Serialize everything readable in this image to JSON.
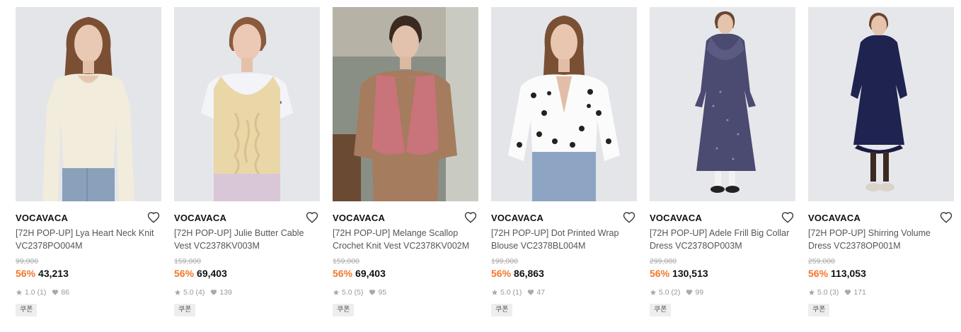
{
  "products": [
    {
      "brand": "VOCAVACA",
      "title": "[72H POP-UP] Lya Heart Neck Knit VC2378PO004M",
      "original_price": "99,000",
      "discount": "56%",
      "price": "43,213",
      "rating": "1.0",
      "reviews": "(1)",
      "likes": "86",
      "coupon": "쿠폰"
    },
    {
      "brand": "VOCAVACA",
      "title": "[72H POP-UP] Julie Butter Cable Vest VC2378KV003M",
      "original_price": "159,000",
      "discount": "56%",
      "price": "69,403",
      "rating": "5.0",
      "reviews": "(4)",
      "likes": "139",
      "coupon": "쿠폰"
    },
    {
      "brand": "VOCAVACA",
      "title": "[72H POP-UP] Melange Scallop Crochet Knit Vest VC2378KV002M",
      "original_price": "159,000",
      "discount": "56%",
      "price": "69,403",
      "rating": "5.0",
      "reviews": "(5)",
      "likes": "95",
      "coupon": "쿠폰"
    },
    {
      "brand": "VOCAVACA",
      "title": "[72H POP-UP] Dot Printed Wrap Blouse VC2378BL004M",
      "original_price": "199,000",
      "discount": "56%",
      "price": "86,863",
      "rating": "5.0",
      "reviews": "(1)",
      "likes": "47",
      "coupon": "쿠폰"
    },
    {
      "brand": "VOCAVACA",
      "title": "[72H POP-UP] Adele Frill Big Collar Dress VC2378OP003M",
      "original_price": "299,000",
      "discount": "56%",
      "price": "130,513",
      "rating": "5.0",
      "reviews": "(2)",
      "likes": "99",
      "coupon": "쿠폰"
    },
    {
      "brand": "VOCAVACA",
      "title": "[72H POP-UP] Shirring Volume Dress VC2378OP001M",
      "original_price": "259,000",
      "discount": "56%",
      "price": "113,053",
      "rating": "5.0",
      "reviews": "(3)",
      "likes": "171",
      "coupon": "쿠폰"
    }
  ],
  "colors": {
    "discount": "#f4762a",
    "price": "#111111",
    "muted": "#999999"
  },
  "icons": {
    "wishlist": "heart-outline-icon",
    "rating": "star-icon",
    "likes": "heart-filled-icon"
  }
}
